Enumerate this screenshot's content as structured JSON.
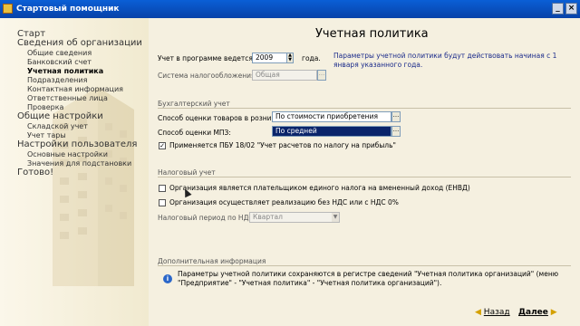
{
  "window": {
    "title": "Стартовый помощник"
  },
  "sidebar": {
    "items": [
      {
        "label": "Старт",
        "level": 1,
        "active": false
      },
      {
        "label": "Сведения об организации",
        "level": 1,
        "active": false
      },
      {
        "label": "Общие сведения",
        "level": 2,
        "active": false
      },
      {
        "label": "Банковский счет",
        "level": 2,
        "active": false
      },
      {
        "label": "Учетная политика",
        "level": 2,
        "active": true
      },
      {
        "label": "Подразделения",
        "level": 2,
        "active": false
      },
      {
        "label": "Контактная информация",
        "level": 2,
        "active": false
      },
      {
        "label": "Ответственные лица",
        "level": 2,
        "active": false
      },
      {
        "label": "Проверка",
        "level": 2,
        "active": false
      },
      {
        "label": "Общие настройки",
        "level": 1,
        "active": false
      },
      {
        "label": "Складской учет",
        "level": 2,
        "active": false
      },
      {
        "label": "Учет тары",
        "level": 2,
        "active": false
      },
      {
        "label": "Настройки пользователя",
        "level": 1,
        "active": false
      },
      {
        "label": "Основные настройки",
        "level": 2,
        "active": false
      },
      {
        "label": "Значения для подстановки",
        "level": 2,
        "active": false
      },
      {
        "label": "Готово!",
        "level": 1,
        "active": false
      }
    ]
  },
  "main": {
    "title": "Учетная политика",
    "year_label": "Учет в программе ведется с:",
    "year_value": "2009",
    "year_suffix": "года.",
    "year_note": "Параметры учетной политики будут действовать начиная с 1 января указанного года.",
    "tax_system_label": "Система налогообложения:",
    "tax_system_value": "Общая",
    "accounting": {
      "title": "Бухгалтерский учет",
      "goods_label": "Способ оценки товаров в рознице:",
      "goods_value": "По стоимости приобретения",
      "mpz_label": "Способ оценки МПЗ:",
      "mpz_value": "По средней",
      "pbu_checked": true,
      "pbu_label": "Применяется ПБУ 18/02 \"Учет расчетов по налогу на прибыль\""
    },
    "tax": {
      "title": "Налоговый учет",
      "envd_checked": false,
      "envd_label": "Организация является плательщиком единого налога на вмененный доход (ЕНВД)",
      "nds0_checked": false,
      "nds0_label": "Организация осуществляет реализацию без НДС или с НДС 0%",
      "nds_period_label": "Налоговый период по НДС:",
      "nds_period_value": "Квартал"
    },
    "extra": {
      "title": "Дополнительная информация",
      "text": "Параметры учетной политики сохраняются в регистре сведений \"Учетная политика организаций\" (меню \"Предприятие\" - \"Учетная политика\" - \"Учетная политика организаций\")."
    }
  },
  "footer": {
    "back_label": "Назад",
    "next_label": "Далее"
  },
  "colors": {
    "titlebar": "#0a5fd6",
    "selection": "#0a246a",
    "note": "#1a2a8a",
    "arrow": "#d4a000"
  }
}
